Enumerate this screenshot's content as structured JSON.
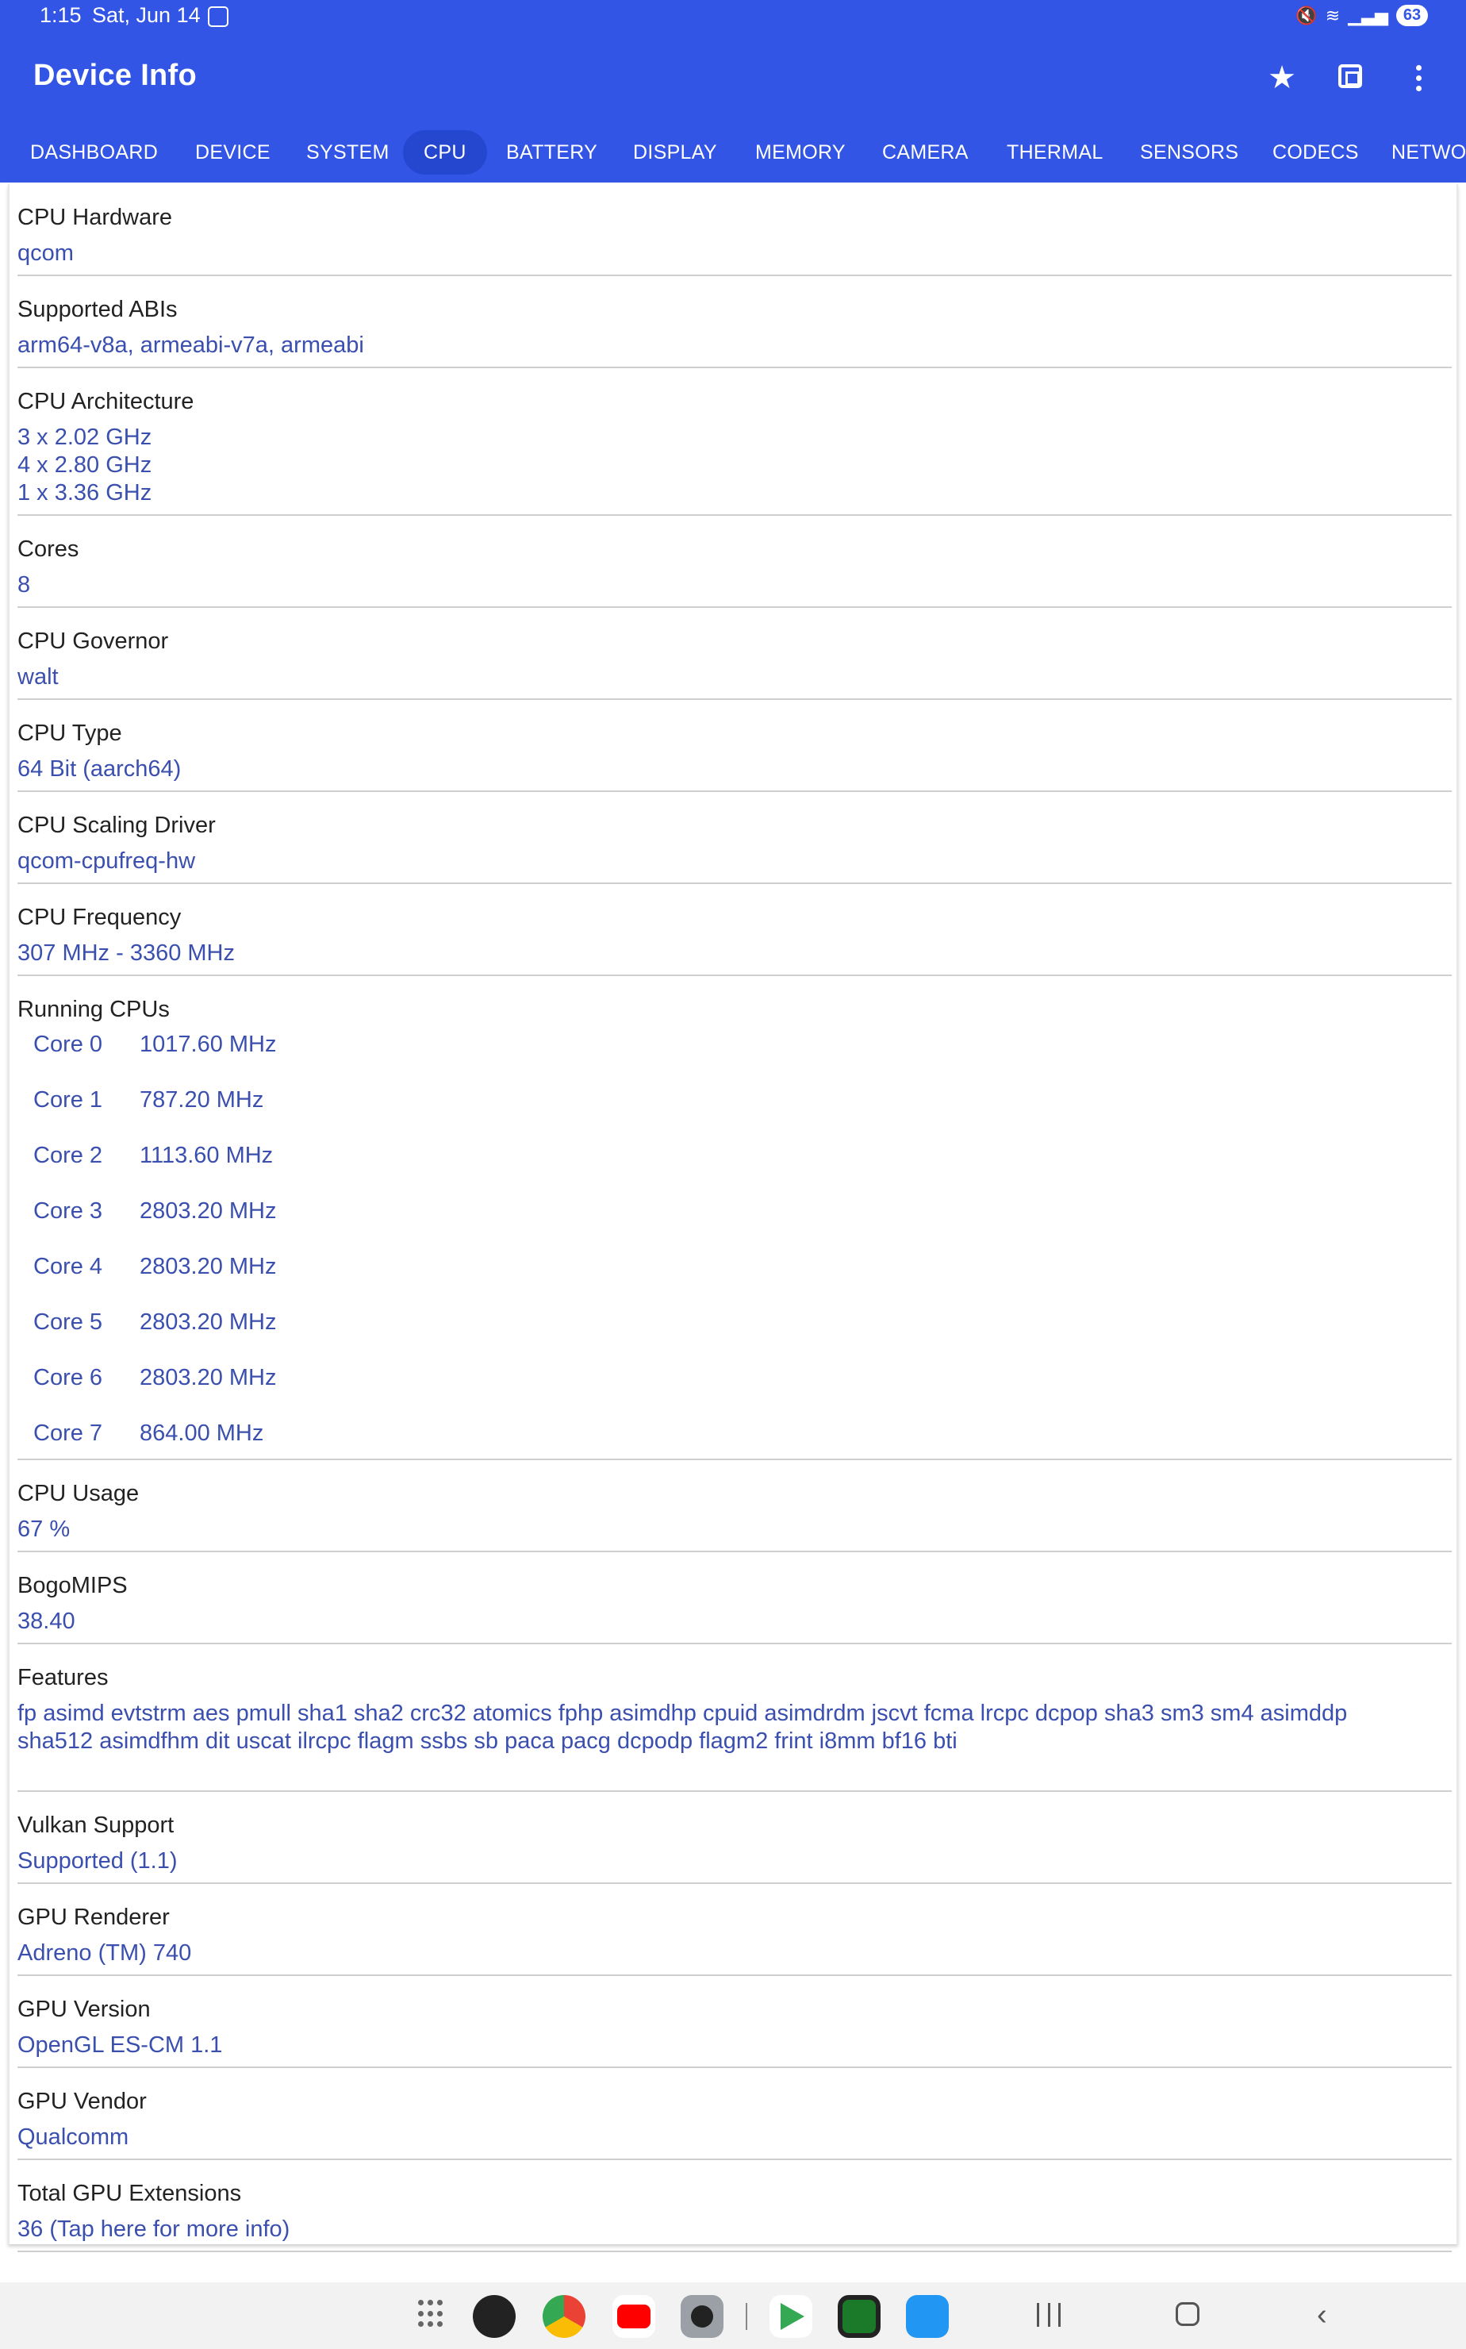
{
  "status_bar": {
    "time": "1:15",
    "date": "Sat, Jun 14",
    "battery": "63"
  },
  "app": {
    "title": "Device Info",
    "header_color": "#3355e6",
    "value_color": "#3a4fae",
    "actions": [
      "star-icon",
      "chip-icon",
      "more-vert-icon"
    ]
  },
  "tabs": [
    {
      "label": "DASHBOARD",
      "active": false
    },
    {
      "label": "DEVICE",
      "active": false
    },
    {
      "label": "SYSTEM",
      "active": false
    },
    {
      "label": "CPU",
      "active": true
    },
    {
      "label": "BATTERY",
      "active": false
    },
    {
      "label": "DISPLAY",
      "active": false
    },
    {
      "label": "MEMORY",
      "active": false
    },
    {
      "label": "CAMERA",
      "active": false
    },
    {
      "label": "THERMAL",
      "active": false
    },
    {
      "label": "SENSORS",
      "active": false
    },
    {
      "label": "CODECS",
      "active": false
    },
    {
      "label": "NETWO",
      "active": false
    }
  ],
  "rows": [
    {
      "label": "CPU Hardware",
      "value": "qcom"
    },
    {
      "label": "Supported ABIs",
      "value": "arm64-v8a, armeabi-v7a, armeabi"
    },
    {
      "label": "CPU Architecture",
      "value": "3 x 2.02 GHz"
    },
    {
      "label": "Cores",
      "value": "8"
    },
    {
      "label": "CPU Governor",
      "value": "walt"
    },
    {
      "label": "CPU Type",
      "value": "64 Bit (aarch64)"
    },
    {
      "label": "CPU Scaling Driver",
      "value": "qcom-cpufreq-hw"
    },
    {
      "label": "CPU Frequency",
      "value": "307 MHz - 3360 MHz"
    },
    {
      "label": "Running CPUs",
      "value": ""
    },
    {
      "label": "CPU Usage",
      "value": "67 %"
    },
    {
      "label": "BogoMIPS",
      "value": "38.40"
    },
    {
      "label": "Features",
      "value": "fp asimd evtstrm aes pmull sha1 sha2 crc32 atomics fphp asimdhp cpuid asimdrdm jscvt fcma lrcpc dcpop sha3 sm3 sm4 asimddp"
    },
    {
      "label": "Vulkan Support",
      "value": "Supported (1.1)"
    },
    {
      "label": "GPU Renderer",
      "value": "Adreno (TM) 740"
    },
    {
      "label": "GPU Version",
      "value": "OpenGL ES-CM 1.1"
    },
    {
      "label": "GPU Vendor",
      "value": "Qualcomm"
    },
    {
      "label": "Total GPU Extensions",
      "value": "36 (Tap here for more info)"
    }
  ],
  "arch_lines": [
    "4 x 2.80 GHz",
    "1 x 3.36 GHz"
  ],
  "features_line2": "sha512 asimdfhm dit uscat ilrcpc flagm ssbs sb paca pacg dcpodp flagm2 frint i8mm bf16 bti",
  "running_cpus": [
    {
      "core": "Core 0",
      "freq": "1017.60 MHz"
    },
    {
      "core": "Core 1",
      "freq": "787.20 MHz"
    },
    {
      "core": "Core 2",
      "freq": "1113.60 MHz"
    },
    {
      "core": "Core 3",
      "freq": "2803.20 MHz"
    },
    {
      "core": "Core 4",
      "freq": "2803.20 MHz"
    },
    {
      "core": "Core 5",
      "freq": "2803.20 MHz"
    },
    {
      "core": "Core 6",
      "freq": "2803.20 MHz"
    },
    {
      "core": "Core 7",
      "freq": "864.00 MHz"
    }
  ],
  "navbar": {
    "apps": [
      "settings-app-icon",
      "chrome-app-icon",
      "youtube-app-icon",
      "camera-app-icon",
      "play-store-app-icon",
      "cpu-z-app-icon",
      "app-store-icon"
    ]
  }
}
